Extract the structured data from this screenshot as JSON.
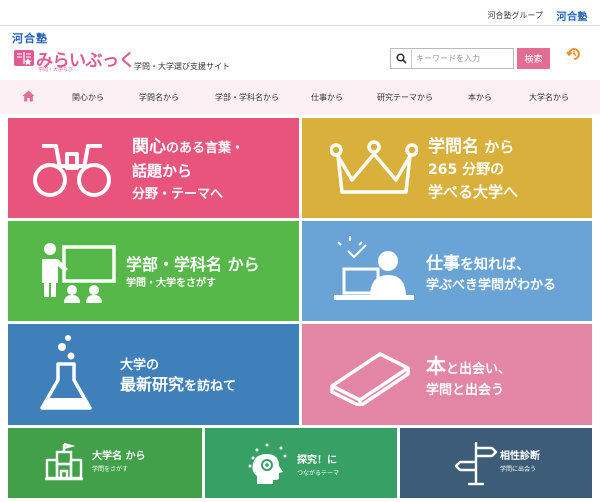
{
  "topbar": {
    "group_label": "河合塾グループ",
    "group_logo": "河合塾"
  },
  "header": {
    "kawai_logo": "河合塾",
    "brand_name": "みらいぶっく",
    "brand_sub": "学問・大学なび",
    "tagline": "学問・大学選び支援サイト",
    "search": {
      "placeholder": "キーワードを入力",
      "button_label": "検索"
    }
  },
  "nav": {
    "items": [
      {
        "label": "関心から"
      },
      {
        "label": "学問名から"
      },
      {
        "label": "学部・学科名から"
      },
      {
        "label": "仕事から"
      },
      {
        "label": "研究テーマから"
      },
      {
        "label": "本から"
      },
      {
        "label": "大学名から"
      }
    ]
  },
  "tiles": {
    "interest": {
      "line1_hl": "関心",
      "line1_rest": "のある言葉・",
      "line2": "話題から",
      "line3": "分野・テーマへ"
    },
    "discipline": {
      "line1_hl": "学問名",
      "line1_rest": "から",
      "line2": "265 分野の",
      "line3": "学べる大学へ"
    },
    "faculty": {
      "line1": "学部・学科名 から",
      "line2": "学問・大学をさがす"
    },
    "job": {
      "line1_hl": "仕事",
      "line1_rest": "を知れば、",
      "line2": "学ぶべき学問がわかる"
    },
    "research": {
      "line1": "大学の",
      "line2_hl": "最新研究",
      "line2_rest": "を訪ねて"
    },
    "book": {
      "line1_hl": "本",
      "line1_rest": "と出会い、",
      "line2": "学問と出会う"
    },
    "university": {
      "line1": "大学名 から",
      "line2": "学問をさがす"
    },
    "explore": {
      "line1": "探究！に",
      "line2": "つながるテーマ"
    },
    "compat": {
      "line1": "相性診断",
      "line2": "学問に出会う"
    }
  },
  "colors": {
    "pink": "#e8547b",
    "gold": "#d9b03c",
    "green": "#57b84a",
    "blue": "#6aa3d6",
    "steel": "#3f7fba",
    "pink2": "#e385a5",
    "green2": "#43a04a",
    "green3": "#36a065",
    "navy": "#3c5c78",
    "brand_pink": "#e46e92",
    "brand_blue": "#2563b8"
  },
  "icons": [
    "search-icon",
    "history-icon",
    "home-icon",
    "binoculars-icon",
    "crown-icon",
    "teacher-board-icon",
    "laptop-person-icon",
    "flask-icon",
    "book-icon",
    "university-building-icon",
    "head-sparkle-icon",
    "signpost-icon"
  ]
}
